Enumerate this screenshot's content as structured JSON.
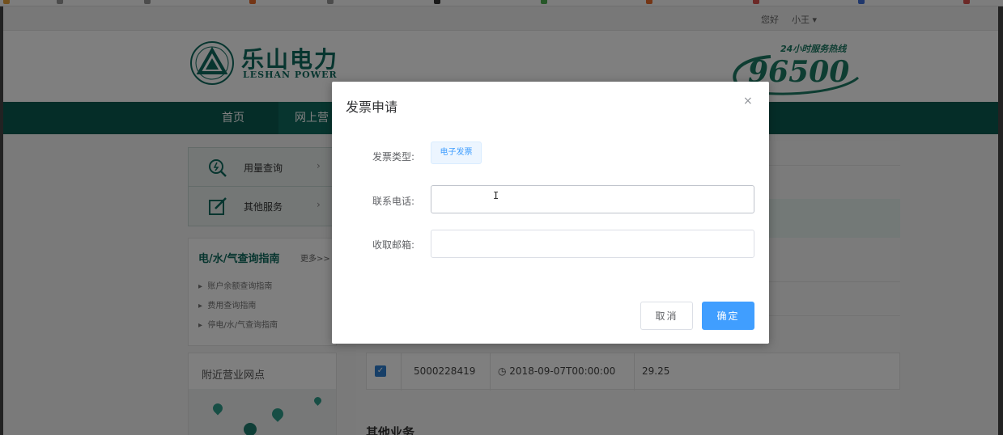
{
  "page": {
    "greeting": "您好",
    "username": "小王 ▾",
    "logo_cn": "乐山电力",
    "logo_en": "LESHAN POWER",
    "hotline_caption": "24小时服务热线",
    "hotline_number": "96500"
  },
  "nav": {
    "items": [
      "首页",
      "网上营"
    ]
  },
  "sidebar": {
    "menu": [
      {
        "label": "用量查询",
        "arrow": "›"
      },
      {
        "label": "其他服务",
        "arrow": "›"
      }
    ],
    "guide": {
      "title": "电/水/气查询指南",
      "more": "更多>>",
      "items": [
        "账户余额查询指南",
        "费用查询指南",
        "停电/水/气查询指南"
      ]
    },
    "nearby_title": "附近营业网点"
  },
  "main": {
    "row": {
      "account": "5000228419",
      "time": "◷ 2018-09-07T00:00:00",
      "amount": "29.25"
    },
    "other_services": "其他业务"
  },
  "dialog": {
    "title": "发票申请",
    "close": "×",
    "fields": {
      "type_label": "发票类型:",
      "type_value": "电子发票",
      "phone_label": "联系电话:",
      "phone_value": "",
      "email_label": "收取邮箱:",
      "email_value": ""
    },
    "cancel": "取消",
    "confirm": "确定"
  },
  "colors": {
    "brand": "#0f6b5e",
    "nav": "#0b5a50",
    "primary": "#409eff"
  }
}
